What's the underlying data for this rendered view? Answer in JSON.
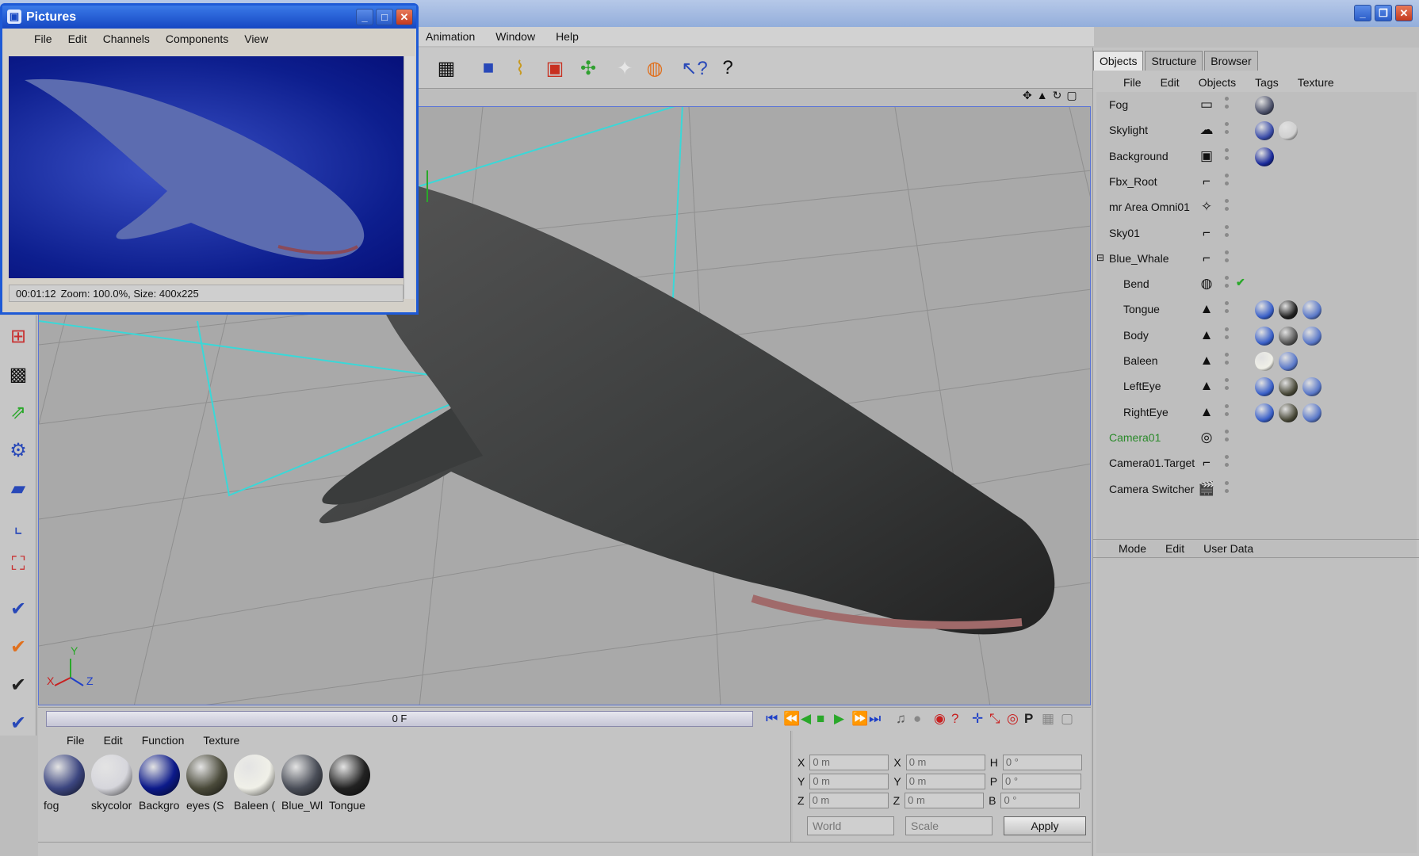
{
  "menubar": {
    "items": [
      "Animation",
      "Window",
      "Help"
    ]
  },
  "viewport": {
    "axes": {
      "y": "Y",
      "x": "X",
      "z": "Z"
    }
  },
  "timeline": {
    "frame": "0 F"
  },
  "material_manager": {
    "menu": [
      "File",
      "Edit",
      "Function",
      "Texture"
    ],
    "materials": [
      {
        "label": "fog",
        "color": "#3c4680"
      },
      {
        "label": "skycolor",
        "color": "#d6d6dc"
      },
      {
        "label": "Backgro",
        "color": "#0c1a8a"
      },
      {
        "label": "eyes (S",
        "color": "#4a4a3a"
      },
      {
        "label": "Baleen (",
        "color": "#f0f0e8"
      },
      {
        "label": "Blue_Wl",
        "color": "#4a4e58"
      },
      {
        "label": "Tongue",
        "color": "#222222"
      }
    ]
  },
  "coordinates": {
    "rows": [
      {
        "a": "X",
        "av": "0 m",
        "b": "X",
        "bv": "0 m",
        "c": "H",
        "cv": "0 °"
      },
      {
        "a": "Y",
        "av": "0 m",
        "b": "Y",
        "bv": "0 m",
        "c": "P",
        "cv": "0 °"
      },
      {
        "a": "Z",
        "av": "0 m",
        "b": "Z",
        "bv": "0 m",
        "c": "B",
        "cv": "0 °"
      }
    ],
    "mode1": "World",
    "mode2": "Scale",
    "apply": "Apply"
  },
  "objects_panel": {
    "tabs": [
      "Objects",
      "Structure",
      "Browser"
    ],
    "menu": [
      "File",
      "Edit",
      "Objects",
      "Tags",
      "Texture"
    ],
    "objects": [
      {
        "name": "Fog",
        "icon": "fog-icon",
        "glyph": "▭",
        "indent": 0
      },
      {
        "name": "Skylight",
        "icon": "sky-icon",
        "glyph": "☁",
        "indent": 0
      },
      {
        "name": "Background",
        "icon": "background-icon",
        "glyph": "▣",
        "indent": 0
      },
      {
        "name": "Fbx_Root",
        "icon": "null-object-icon",
        "glyph": "⌐",
        "indent": 0
      },
      {
        "name": "mr Area Omni01",
        "icon": "light-icon",
        "glyph": "✧",
        "indent": 0
      },
      {
        "name": "Sky01",
        "icon": "null-object-icon",
        "glyph": "⌐",
        "indent": 0
      },
      {
        "name": "Blue_Whale",
        "icon": "null-object-icon",
        "glyph": "⌐",
        "indent": 0
      },
      {
        "name": "Bend",
        "icon": "bend-deformer-icon",
        "glyph": "◍",
        "indent": 1
      },
      {
        "name": "Tongue",
        "icon": "polygon-object-icon",
        "glyph": "▲",
        "indent": 1
      },
      {
        "name": "Body",
        "icon": "polygon-object-icon",
        "glyph": "▲",
        "indent": 1
      },
      {
        "name": "Baleen",
        "icon": "polygon-object-icon",
        "glyph": "▲",
        "indent": 1
      },
      {
        "name": "LeftEye",
        "icon": "polygon-object-icon",
        "glyph": "▲",
        "indent": 1
      },
      {
        "name": "RightEye",
        "icon": "polygon-object-icon",
        "glyph": "▲",
        "indent": 1
      },
      {
        "name": "Camera01",
        "icon": "camera-icon",
        "glyph": "◎",
        "indent": 0
      },
      {
        "name": "Camera01.Target",
        "icon": "null-object-icon",
        "glyph": "⌐",
        "indent": 0
      },
      {
        "name": "Camera Switcher",
        "icon": "clapper-icon",
        "glyph": "🎬",
        "indent": 0
      }
    ],
    "attr_menu": [
      "Mode",
      "Edit",
      "User Data"
    ]
  },
  "pictures_window": {
    "title": "Pictures",
    "menu": [
      "File",
      "Edit",
      "Channels",
      "Components",
      "View"
    ],
    "status_time": "00:01:12",
    "status_info": "Zoom: 100.0%, Size: 400x225"
  },
  "colors": {
    "accent": "#1e5ad6",
    "camera_label": "#2a8a2a",
    "timeline_ctrl": "#1d3fc8"
  }
}
